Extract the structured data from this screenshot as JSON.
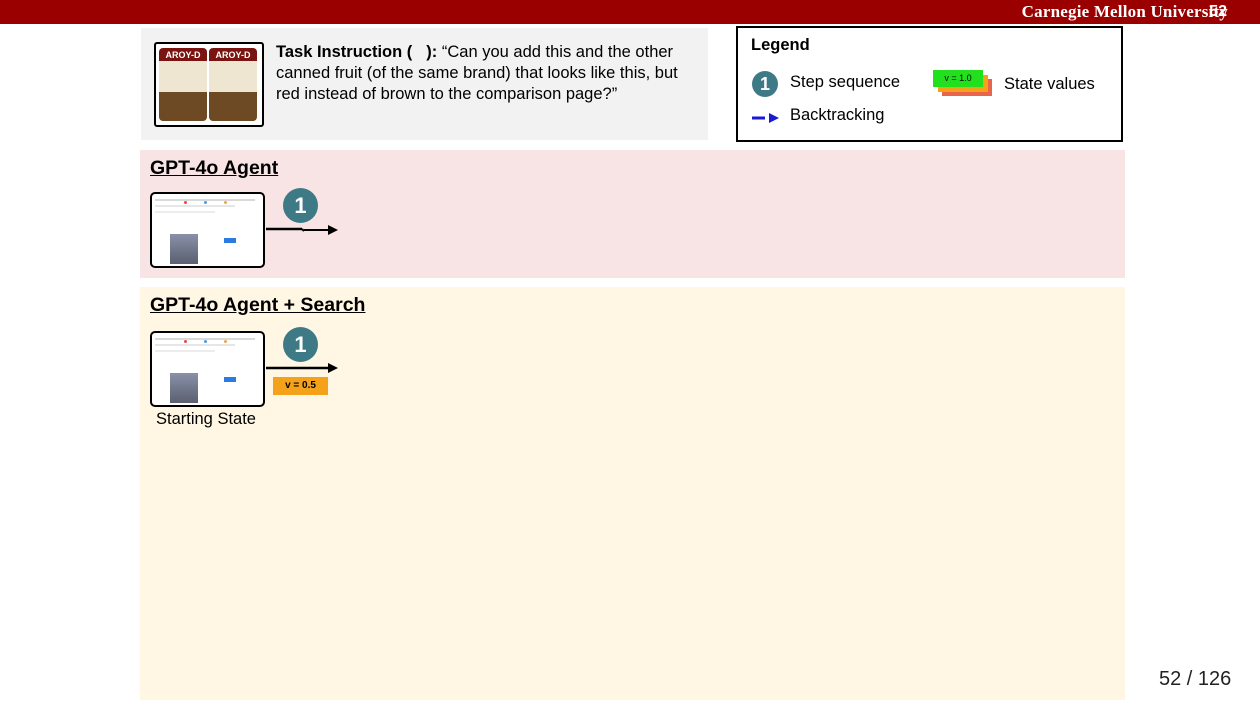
{
  "header": {
    "brand": "Carnegie Mellon University",
    "slide_number": "52"
  },
  "task": {
    "label": "Task Instruction (",
    "label_close": "):",
    "text": "“Can you add this and the other canned fruit (of the same brand) that looks like this, but red instead of brown to the comparison page?”",
    "image_can_text": "AROY-D"
  },
  "legend": {
    "title": "Legend",
    "step_number": "1",
    "step_label": "Step sequence",
    "backtracking_label": "Backtracking",
    "value_sample": "v = 1.0",
    "values_label": "State values",
    "colors": {
      "step": "#3e7a86",
      "backtrack": "#1a1ad6",
      "value_top": "#22e01e",
      "value_mid": "#f5a21b",
      "value_back": "#e8654a"
    }
  },
  "panels": [
    {
      "title": "GPT-4o Agent",
      "step_number": "1",
      "color": "#f8e4e5"
    },
    {
      "title": "GPT-4o Agent + Search",
      "step_number": "1",
      "value": "v = 0.5",
      "caption": "Starting State",
      "color": "#fff6e3"
    }
  ],
  "footer": {
    "page_counter": "52 / 126"
  },
  "icons": [
    "step-circle",
    "arrow-right-icon",
    "backtrack-arrow-icon",
    "product-cans-image",
    "screenshot-thumbnail"
  ]
}
